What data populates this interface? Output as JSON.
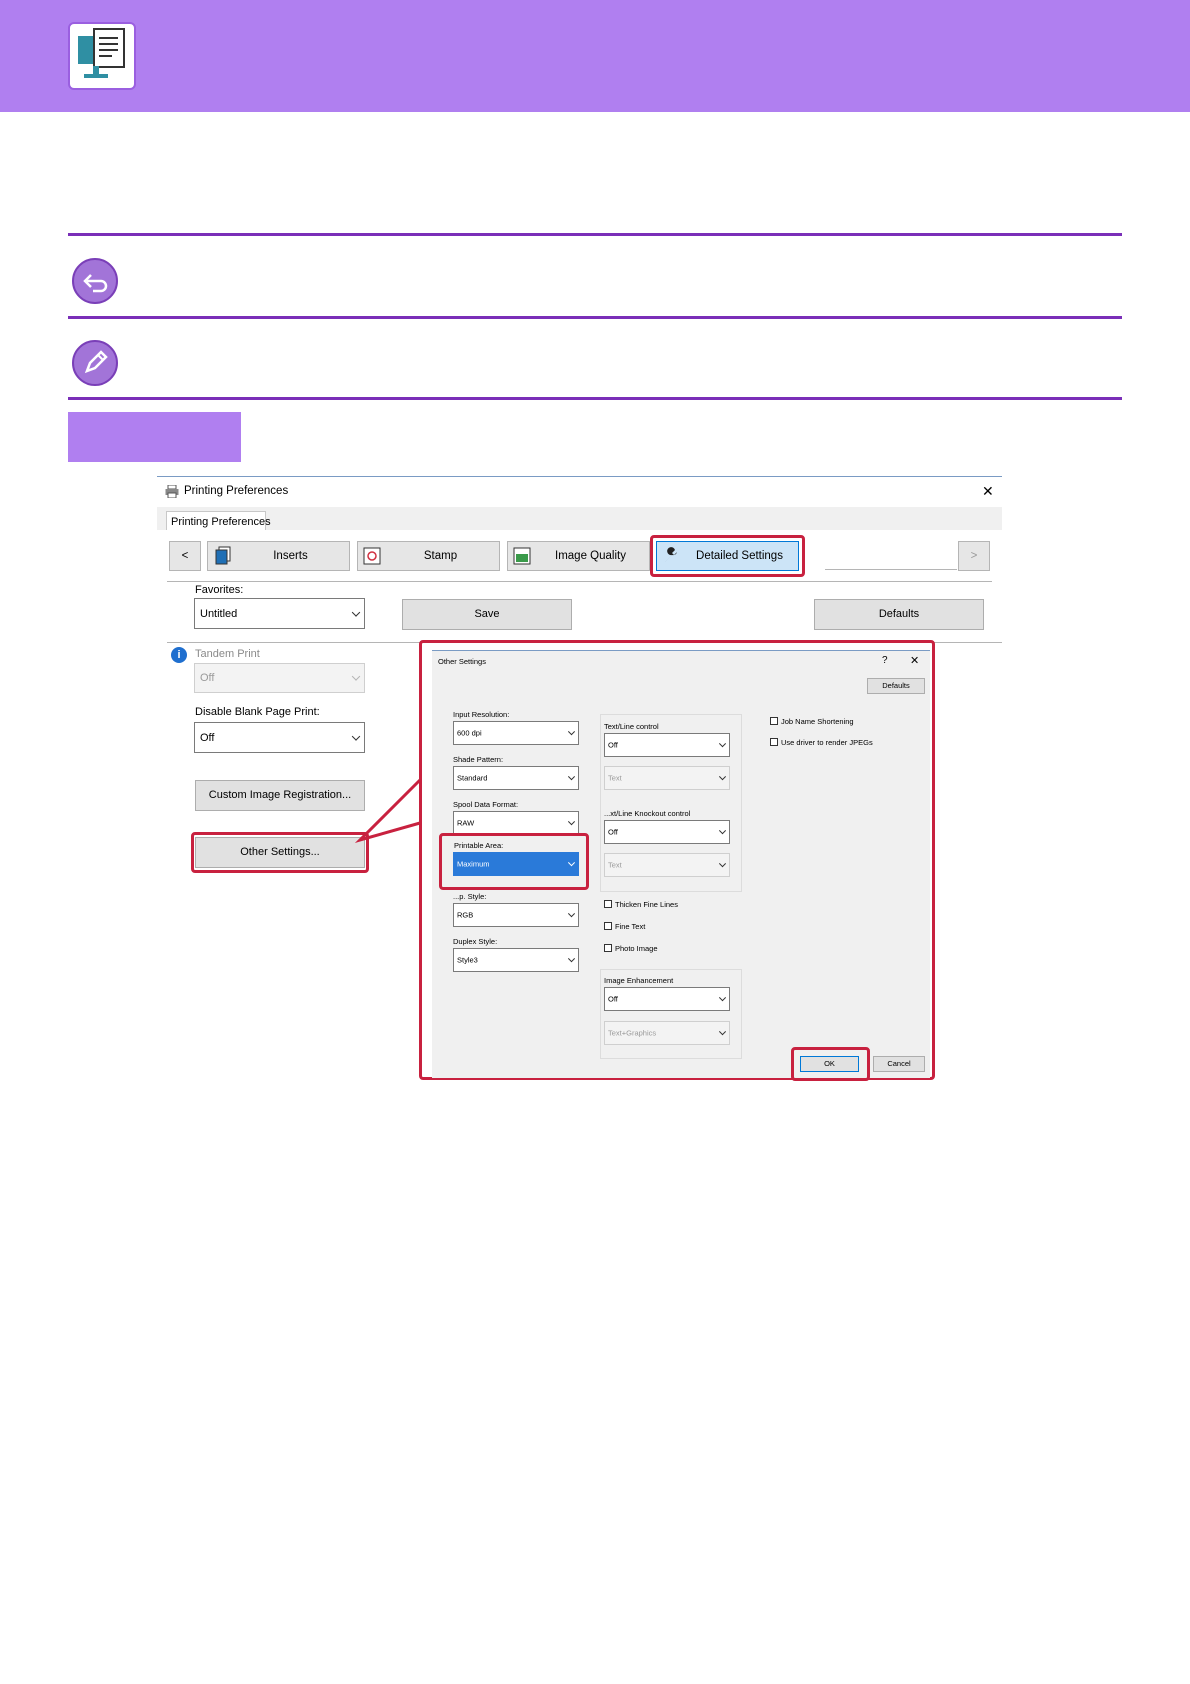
{
  "window": {
    "title": "Printing Preferences",
    "tab_label": "Printing Preferences",
    "nav_prev": "<",
    "nav_next": ">",
    "tabs": [
      "Inserts",
      "Stamp",
      "Image Quality",
      "Detailed Settings"
    ],
    "favorites_label": "Favorites:",
    "favorites_value": "Untitled",
    "save": "Save",
    "defaults": "Defaults",
    "tandem_label": "Tandem Print",
    "tandem_value": "Off",
    "blank_label": "Disable Blank Page Print:",
    "blank_value": "Off",
    "custom_image": "Custom Image Registration...",
    "other_settings": "Other Settings..."
  },
  "other": {
    "title": "Other Settings",
    "help": "?",
    "close": "✕",
    "defaults": "Defaults",
    "input_res_label": "Input Resolution:",
    "input_res_value": "600 dpi",
    "shade_label": "Shade Pattern:",
    "shade_value": "Standard",
    "spool_label": "Spool Data Format:",
    "spool_value": "RAW",
    "printable_label": "Printable Area:",
    "printable_value": "Maximum",
    "rgb_label": "...p. Style:",
    "rgb_value": "RGB",
    "duplex_label": "Duplex Style:",
    "duplex_value": "Style3",
    "textline_label": "Text/Line control",
    "textline_value": "Off",
    "textline_sub": "Text",
    "knockout_label": "...xt/Line Knockout control",
    "knockout_value": "Off",
    "knockout_sub": "Text",
    "thicken": "Thicken Fine Lines",
    "finetext": "Fine Text",
    "photo": "Photo Image",
    "enh_label": "Image Enhancement",
    "enh_value": "Off",
    "enh_sub": "Text+Graphics",
    "job_name": "Job Name Shortening",
    "jpeg": "Use driver to render JPEGs",
    "ok": "OK",
    "cancel": "Cancel"
  },
  "colors": {
    "accent": "#b07ff0",
    "highlight": "#c8213f"
  }
}
